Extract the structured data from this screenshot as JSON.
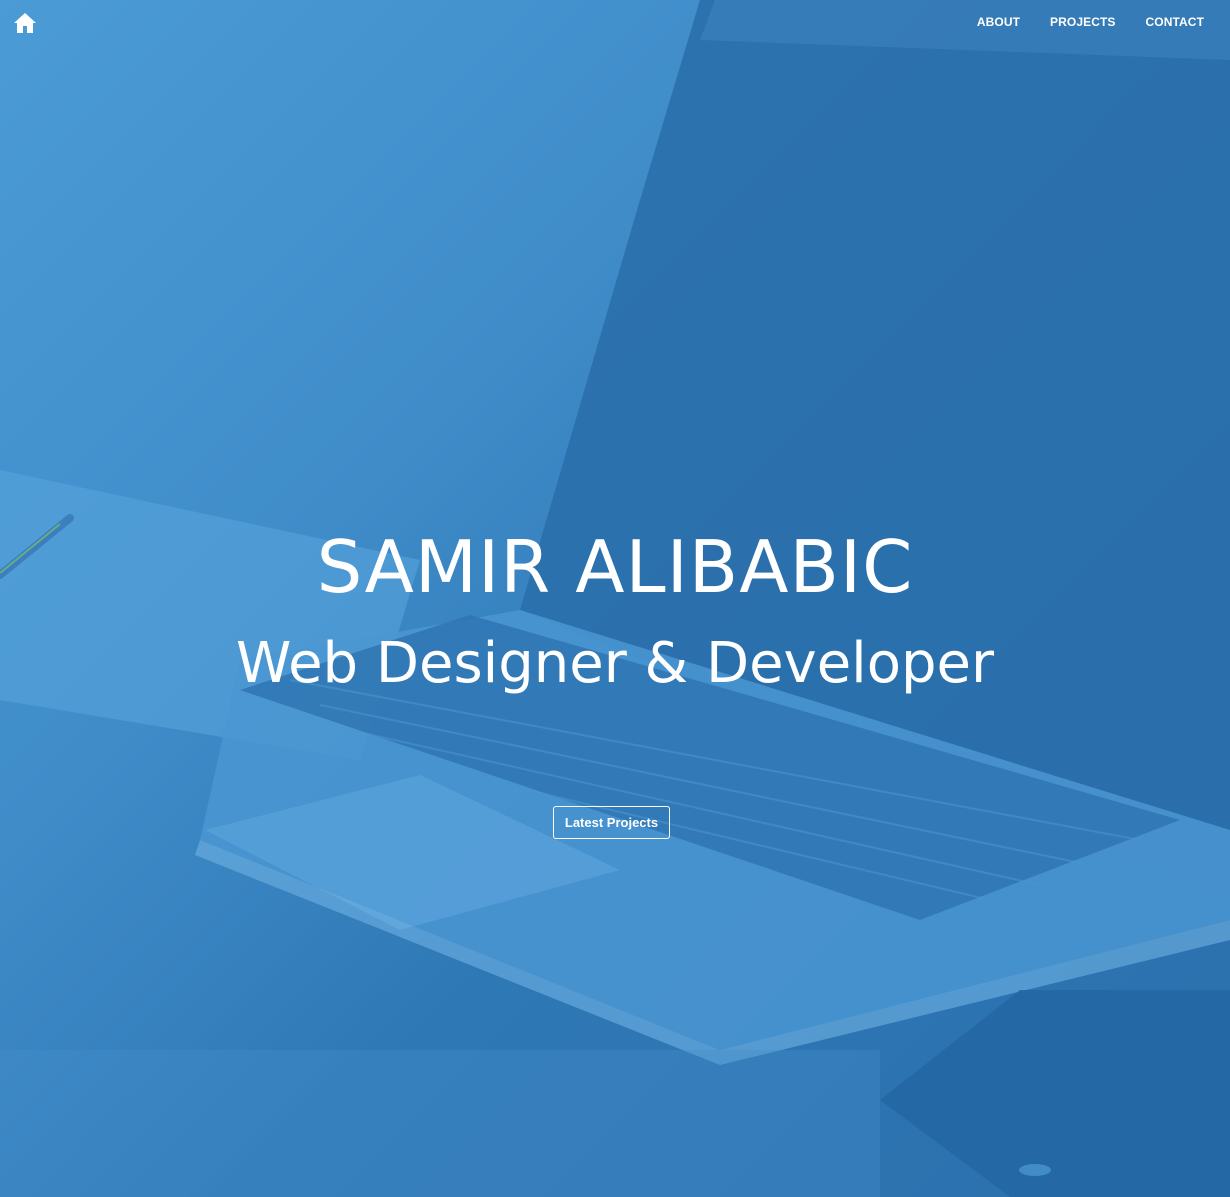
{
  "nav": {
    "home_icon": "home-icon",
    "links": [
      {
        "label": "ABOUT"
      },
      {
        "label": "PROJECTS"
      },
      {
        "label": "CONTACT"
      }
    ]
  },
  "hero": {
    "title": "SAMIR ALIBABIC",
    "subtitle": "Web Designer & Developer",
    "cta_label": "Latest Projects",
    "background_image": "laptop-desk-photo",
    "overlay_color": "#2f7fc4"
  }
}
